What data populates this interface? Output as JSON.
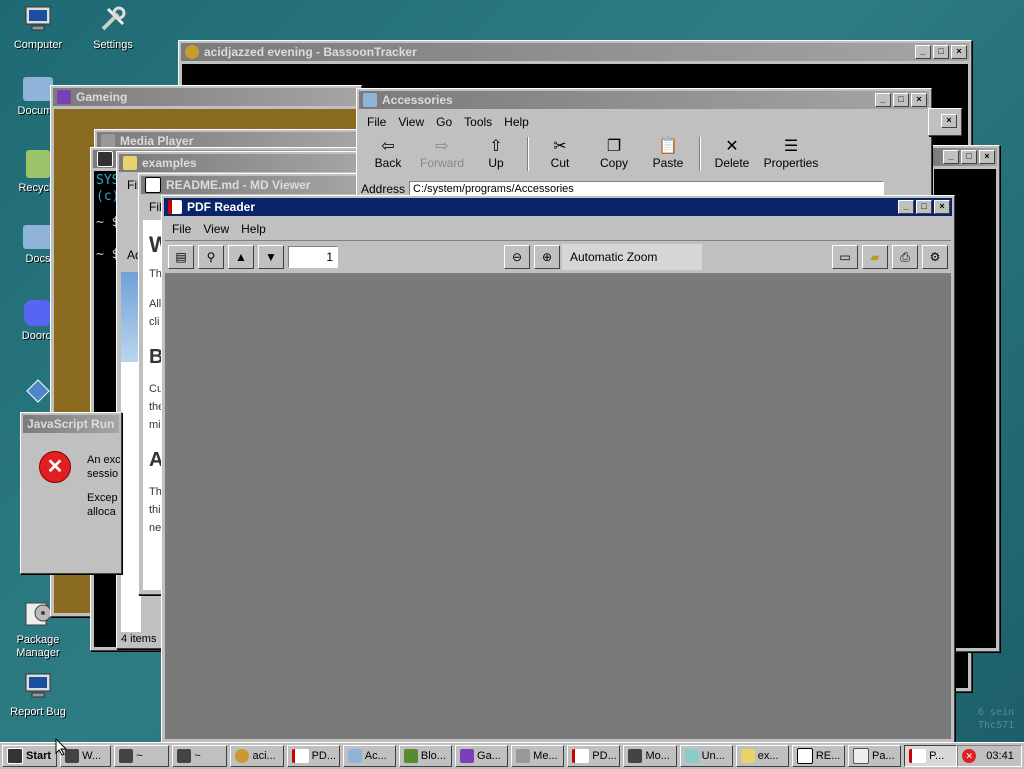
{
  "desktop": {
    "icons": [
      {
        "label": "Computer"
      },
      {
        "label": "Settings"
      },
      {
        "label": "Docume"
      },
      {
        "label": "Recycle"
      },
      {
        "label": "Docs"
      },
      {
        "label": "Doordi"
      },
      {
        "label": "Package Manager"
      },
      {
        "label": "Report Bug"
      }
    ]
  },
  "windows": {
    "bassoon": {
      "title": "acidjazzed evening - BassoonTracker"
    },
    "gameing": {
      "title": "Gameing"
    },
    "media": {
      "title": "Media Player"
    },
    "terminal": {
      "lines": [
        "SYS",
        "(c)",
        "~ $",
        "~ $"
      ]
    },
    "examples": {
      "title": "examples",
      "menu_file": "Fil",
      "address_prefix": "Ad",
      "status": "4 items"
    },
    "readme": {
      "title": "README.md - MD Viewer",
      "menu_file": "File",
      "text": [
        "W",
        "Th",
        "All",
        "cli",
        "B",
        "Cu",
        "the",
        "mi",
        "A",
        "Th",
        "thi",
        "ne"
      ]
    },
    "js": {
      "title": "JavaScript Run",
      "msg1": "An exc",
      "msg2": "sessio",
      "msg3": "Excep",
      "msg4": "alloca"
    },
    "accessories": {
      "title": "Accessories",
      "menu": [
        "File",
        "View",
        "Go",
        "Tools",
        "Help"
      ],
      "toolbar": [
        {
          "label": "Back"
        },
        {
          "label": "Forward"
        },
        {
          "label": "Up"
        },
        {
          "label": "Cut"
        },
        {
          "label": "Copy"
        },
        {
          "label": "Paste"
        },
        {
          "label": "Delete"
        },
        {
          "label": "Properties"
        }
      ],
      "address_label": "Address",
      "address_value": "C:/system/programs/Accessories"
    },
    "pdf": {
      "title": "PDF Reader",
      "menu": [
        "File",
        "View",
        "Help"
      ],
      "page_number": "1",
      "zoom": "Automatic Zoom"
    },
    "term2": {
      "lines": [
        "6 sein",
        "Thc571"
      ]
    }
  },
  "taskbar": {
    "start": "Start",
    "tasks": [
      {
        "label": "W..."
      },
      {
        "label": "~"
      },
      {
        "label": "~"
      },
      {
        "label": "aci..."
      },
      {
        "label": "PD..."
      },
      {
        "label": "Ac..."
      },
      {
        "label": "Blo..."
      },
      {
        "label": "Ga..."
      },
      {
        "label": "Me..."
      },
      {
        "label": "PD..."
      },
      {
        "label": "Mo..."
      },
      {
        "label": "Un..."
      },
      {
        "label": "ex..."
      },
      {
        "label": "RE..."
      },
      {
        "label": "Pa..."
      },
      {
        "label": "P..."
      }
    ],
    "clock": "03:41"
  },
  "colors": {
    "active_title": "#0a246a",
    "inactive_title": "#7b7b7b",
    "desktop": "#1f6a72"
  }
}
